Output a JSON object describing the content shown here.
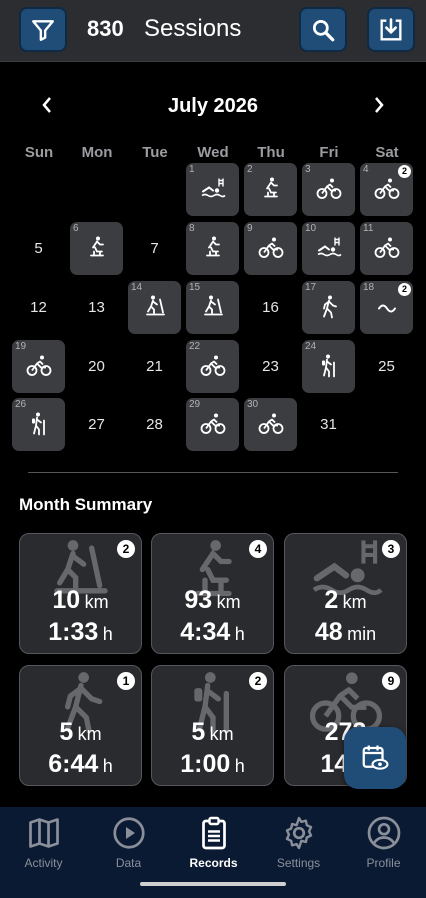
{
  "header": {
    "session_count": "830",
    "sessions_label": "Sessions",
    "filter_icon": "filter-icon",
    "search_icon": "search-icon",
    "download_icon": "download-icon"
  },
  "calendar": {
    "month_label": "July 2026",
    "weekdays": [
      "Sun",
      "Mon",
      "Tue",
      "Wed",
      "Thu",
      "Fri",
      "Sat"
    ],
    "active_days": [
      {
        "day": "1",
        "activity": "swim"
      },
      {
        "day": "2",
        "activity": "cycle-indoor"
      },
      {
        "day": "3",
        "activity": "bike",
        "badge": ""
      },
      {
        "day": "4",
        "activity": "bike",
        "badge": "2"
      },
      {
        "day": "6",
        "activity": "cycle-indoor"
      },
      {
        "day": "8",
        "activity": "cycle-indoor"
      },
      {
        "day": "9",
        "activity": "bike"
      },
      {
        "day": "10",
        "activity": "swim"
      },
      {
        "day": "11",
        "activity": "bike"
      },
      {
        "day": "14",
        "activity": "treadmill"
      },
      {
        "day": "15",
        "activity": "treadmill"
      },
      {
        "day": "17",
        "activity": "walk"
      },
      {
        "day": "18",
        "activity": "mixed",
        "badge": "2"
      },
      {
        "day": "19",
        "activity": "bike"
      },
      {
        "day": "22",
        "activity": "bike"
      },
      {
        "day": "24",
        "activity": "hike"
      },
      {
        "day": "26",
        "activity": "hike"
      },
      {
        "day": "29",
        "activity": "bike"
      },
      {
        "day": "30",
        "activity": "bike"
      }
    ],
    "plain_days": [
      "5",
      "7",
      "12",
      "13",
      "16",
      "20",
      "21",
      "23",
      "25",
      "27",
      "28",
      "31"
    ]
  },
  "summary": {
    "title": "Month Summary",
    "cards": [
      {
        "icon": "treadmill-icon",
        "count": "2",
        "v1": "10",
        "u1": "km",
        "v2": "1:33",
        "u2": "h"
      },
      {
        "icon": "indoor-cycling-icon",
        "count": "4",
        "v1": "93",
        "u1": "km",
        "v2": "4:34",
        "u2": "h"
      },
      {
        "icon": "swimming-icon",
        "count": "3",
        "v1": "2",
        "u1": "km",
        "v2": "48",
        "u2": "min"
      },
      {
        "icon": "walking-icon",
        "count": "1",
        "v1": "5",
        "u1": "km",
        "v2": "6:44",
        "u2": "h"
      },
      {
        "icon": "hiking-icon",
        "count": "2",
        "v1": "5",
        "u1": "km",
        "v2": "1:00",
        "u2": "h"
      },
      {
        "icon": "mountain-bike-icon",
        "count": "9",
        "v1": "273",
        "u1": "",
        "v2": "14:2",
        "u2": ""
      }
    ]
  },
  "nav": [
    {
      "label": "Activity",
      "icon": "map-icon"
    },
    {
      "label": "Data",
      "icon": "play-icon"
    },
    {
      "label": "Records",
      "icon": "clipboard-icon",
      "active": true
    },
    {
      "label": "Settings",
      "icon": "gear-icon"
    },
    {
      "label": "Profile",
      "icon": "profile-icon"
    }
  ],
  "colors": {
    "accent": "#1f4d78",
    "nav_bg": "#0b1a33",
    "tile": "#3c3d40"
  }
}
